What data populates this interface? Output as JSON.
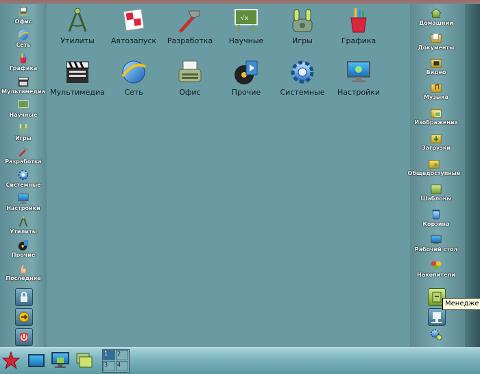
{
  "left_sidebar": [
    {
      "label": "Офис",
      "icon": "office-icon"
    },
    {
      "label": "Сеть",
      "icon": "network-icon"
    },
    {
      "label": "Графика",
      "icon": "graphics-icon"
    },
    {
      "label": "Мультимедиа",
      "icon": "multimedia-icon"
    },
    {
      "label": "Научные",
      "icon": "science-icon"
    },
    {
      "label": "Игры",
      "icon": "games-icon"
    },
    {
      "label": "Разработка",
      "icon": "development-icon"
    },
    {
      "label": "Системные",
      "icon": "system-icon"
    },
    {
      "label": "Настройки",
      "icon": "settings-icon"
    },
    {
      "label": "Утилиты",
      "icon": "utilities-icon"
    },
    {
      "label": "Прочие",
      "icon": "other-icon"
    },
    {
      "label": "Последние",
      "icon": "recent-icon"
    }
  ],
  "left_actions": [
    "lock-icon",
    "switch-user-icon",
    "shutdown-icon"
  ],
  "desktop_row1": [
    {
      "label": "Утилиты",
      "icon": "utilities-icon"
    },
    {
      "label": "Автозапуск",
      "icon": "autostart-icon"
    },
    {
      "label": "Разработка",
      "icon": "development-icon"
    },
    {
      "label": "Научные",
      "icon": "science-icon"
    },
    {
      "label": "Игры",
      "icon": "games-icon"
    },
    {
      "label": "Графика",
      "icon": "graphics-icon"
    }
  ],
  "desktop_row2": [
    {
      "label": "Мультимедиа",
      "icon": "multimedia-icon"
    },
    {
      "label": "Сеть",
      "icon": "network-icon"
    },
    {
      "label": "Офис",
      "icon": "office-icon"
    },
    {
      "label": "Прочие",
      "icon": "other-icon"
    },
    {
      "label": "Системные",
      "icon": "system-icon"
    },
    {
      "label": "Настройки",
      "icon": "settings-icon"
    }
  ],
  "right_sidebar": [
    {
      "label": "Домашний",
      "icon": "home-folder-icon"
    },
    {
      "label": "Документы",
      "icon": "documents-folder-icon"
    },
    {
      "label": "Видео",
      "icon": "video-folder-icon"
    },
    {
      "label": "Музыка",
      "icon": "music-folder-icon"
    },
    {
      "label": "Изображения",
      "icon": "pictures-folder-icon"
    },
    {
      "label": "Загрузки",
      "icon": "downloads-folder-icon"
    },
    {
      "label": "Общедоступные",
      "icon": "public-folder-icon"
    },
    {
      "label": "Шаблоны",
      "icon": "templates-folder-icon"
    },
    {
      "label": "Корзина",
      "icon": "trash-icon"
    },
    {
      "label": "Рабочий стол",
      "icon": "desktop-folder-icon"
    },
    {
      "label": "Накопители",
      "icon": "drives-icon"
    }
  ],
  "right_actions": [
    "file-manager-icon",
    "network-places-icon",
    "system-settings-icon"
  ],
  "tooltip": "Менедже",
  "panel": {
    "start_icon": "start-star-icon",
    "launchers": [
      "show-desktop-icon",
      "display-icon",
      "windows-icon"
    ],
    "workspaces": [
      "1",
      "2",
      "3",
      "4"
    ]
  },
  "colors": {
    "desktop": "#6a9ba3",
    "panel": "#7db6c0",
    "label_text": "#0f1c1e"
  }
}
